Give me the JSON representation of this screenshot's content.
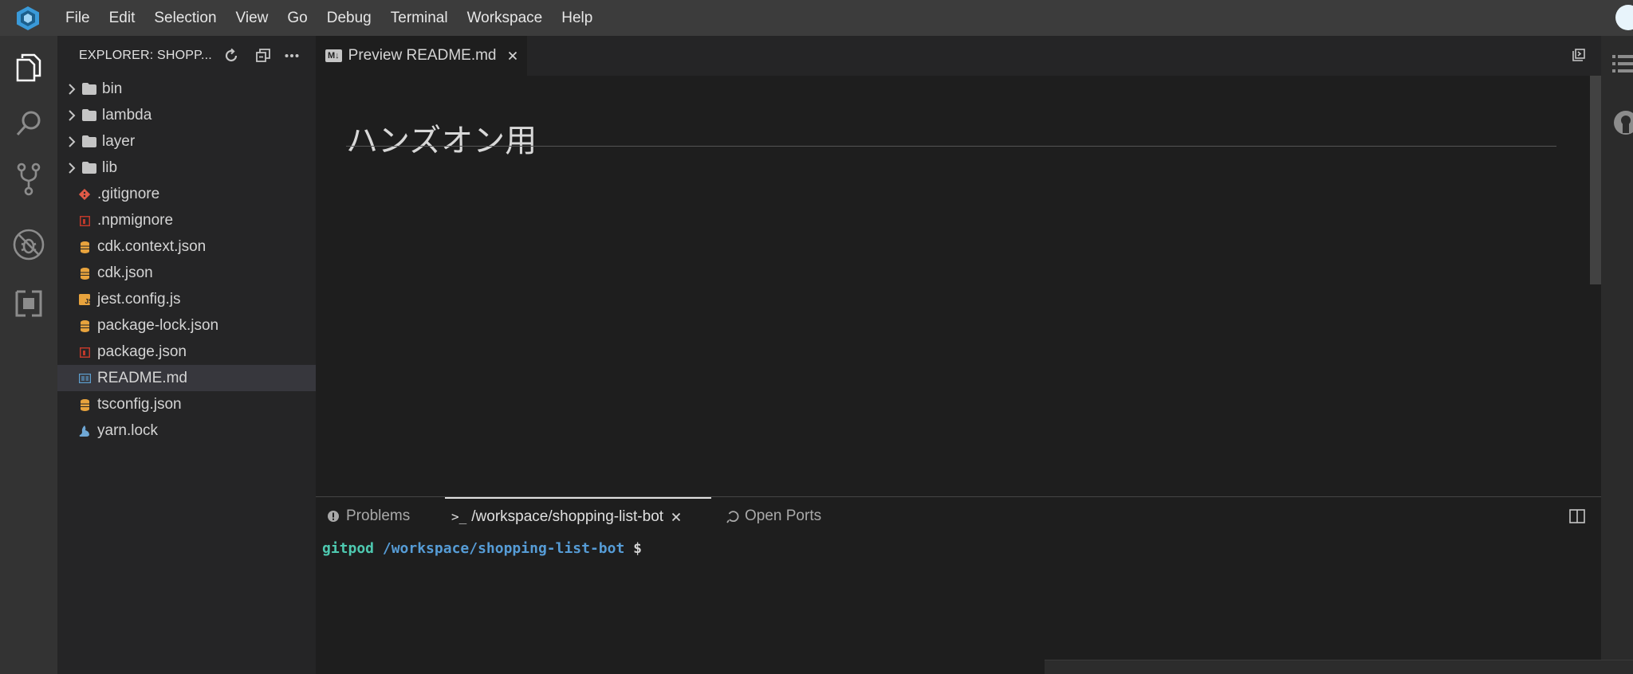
{
  "menubar": {
    "items": [
      "File",
      "Edit",
      "Selection",
      "View",
      "Go",
      "Debug",
      "Terminal",
      "Workspace",
      "Help"
    ]
  },
  "explorer": {
    "title": "EXPLORER: SHOPP...",
    "folders": [
      "bin",
      "lambda",
      "layer",
      "lib"
    ],
    "files": [
      {
        "name": ".gitignore",
        "icon": "git-icon",
        "color": "#e05a47"
      },
      {
        "name": ".npmignore",
        "icon": "npm-icon",
        "color": "#c0392b"
      },
      {
        "name": "cdk.context.json",
        "icon": "database-icon",
        "color": "#e8a33d"
      },
      {
        "name": "cdk.json",
        "icon": "database-icon",
        "color": "#e8a33d"
      },
      {
        "name": "jest.config.js",
        "icon": "js-icon",
        "color": "#e8a33d"
      },
      {
        "name": "package-lock.json",
        "icon": "database-icon",
        "color": "#e8a33d"
      },
      {
        "name": "package.json",
        "icon": "npm-icon",
        "color": "#c0392b"
      },
      {
        "name": "README.md",
        "icon": "markdown-icon",
        "color": "#5d9fd0"
      },
      {
        "name": "tsconfig.json",
        "icon": "database-icon",
        "color": "#e8a33d"
      },
      {
        "name": "yarn.lock",
        "icon": "yarn-icon",
        "color": "#6fa8d6"
      }
    ],
    "selected_file": "README.md"
  },
  "editor": {
    "tab_label": "Preview README.md",
    "tab_icon_text": "M↓",
    "heading": "ハンズオン用"
  },
  "panel": {
    "tabs": {
      "problems": "Problems",
      "terminal": "/workspace/shopping-list-bot",
      "terminal_prefix": ">_",
      "ports": "Open Ports"
    },
    "terminal": {
      "user": "gitpod",
      "path": "/workspace/shopping-list-bot",
      "prompt": "$"
    }
  },
  "colors": {
    "accent": "#3a9ad9",
    "terminal_user": "#4ec9b0",
    "terminal_path": "#569cd6",
    "selected_row": "#37373d"
  }
}
